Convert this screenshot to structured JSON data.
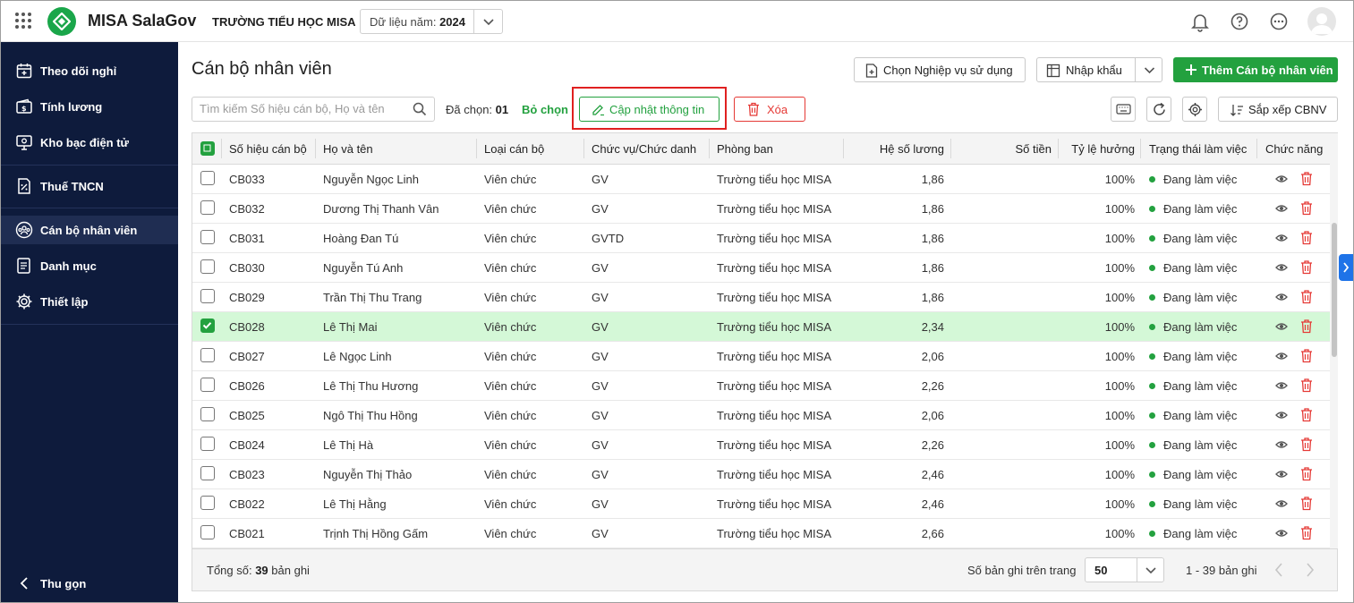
{
  "header": {
    "app_name": "MISA SalaGov",
    "org_name": "TRƯỜNG TIỂU HỌC MISA",
    "year_label": "Dữ liệu năm: ",
    "year_value": "2024",
    "brand_color": "#1aa64a"
  },
  "sidebar": {
    "items": [
      {
        "label": "Theo dõi nghỉ",
        "icon": "calendar-icon"
      },
      {
        "label": "Tính lương",
        "icon": "payroll-icon"
      },
      {
        "label": "Kho bạc điện tử",
        "icon": "treasury-icon"
      },
      {
        "label": "Thuế TNCN",
        "icon": "tax-icon"
      },
      {
        "label": "Cán bộ nhân viên",
        "icon": "staff-icon",
        "active": true
      },
      {
        "label": "Danh mục",
        "icon": "catalog-icon"
      },
      {
        "label": "Thiết lập",
        "icon": "gear-icon"
      }
    ],
    "collapse_label": "Thu gọn"
  },
  "main": {
    "title": "Cán bộ nhân viên",
    "choose_business_label": "Chọn Nghiệp vụ sử dụng",
    "import_label": "Nhập khẩu",
    "add_label": "Thêm Cán bộ nhân viên",
    "search_placeholder": "Tìm kiếm Số hiệu cán bộ, Họ và tên",
    "selected_prefix": "Đã chọn: ",
    "selected_count": "01",
    "deselect_label": "Bỏ chọn",
    "update_label": "Cập nhật thông tin",
    "delete_label": "Xóa",
    "sort_label": "Sắp xếp CBNV"
  },
  "table": {
    "columns": [
      "Số hiệu cán bộ",
      "Họ và tên",
      "Loại cán bộ",
      "Chức vụ/Chức danh",
      "Phòng ban",
      "Hệ số lương",
      "Số tiền",
      "Tỷ lệ hưởng",
      "Trạng thái làm việc",
      "Chức năng"
    ],
    "rows": [
      {
        "id": "CB033",
        "name": "Nguyễn Ngọc Linh",
        "type": "Viên chức",
        "position": "GV",
        "dept": "Trường tiểu học MISA",
        "coef": "1,86",
        "amount": "",
        "rate": "100%",
        "status": "Đang làm việc",
        "checked": false
      },
      {
        "id": "CB032",
        "name": "Dương Thị Thanh Vân",
        "type": "Viên chức",
        "position": "GV",
        "dept": "Trường tiểu học MISA",
        "coef": "1,86",
        "amount": "",
        "rate": "100%",
        "status": "Đang làm việc",
        "checked": false
      },
      {
        "id": "CB031",
        "name": "Hoàng Đan Tú",
        "type": "Viên chức",
        "position": "GVTD",
        "dept": "Trường tiểu học MISA",
        "coef": "1,86",
        "amount": "",
        "rate": "100%",
        "status": "Đang làm việc",
        "checked": false
      },
      {
        "id": "CB030",
        "name": "Nguyễn Tú Anh",
        "type": "Viên chức",
        "position": "GV",
        "dept": "Trường tiểu học MISA",
        "coef": "1,86",
        "amount": "",
        "rate": "100%",
        "status": "Đang làm việc",
        "checked": false
      },
      {
        "id": "CB029",
        "name": "Trần Thị Thu Trang",
        "type": "Viên chức",
        "position": "GV",
        "dept": "Trường tiểu học MISA",
        "coef": "1,86",
        "amount": "",
        "rate": "100%",
        "status": "Đang làm việc",
        "checked": false
      },
      {
        "id": "CB028",
        "name": "Lê Thị Mai",
        "type": "Viên chức",
        "position": "GV",
        "dept": "Trường tiểu học MISA",
        "coef": "2,34",
        "amount": "",
        "rate": "100%",
        "status": "Đang làm việc",
        "checked": true
      },
      {
        "id": "CB027",
        "name": "Lê Ngọc Linh",
        "type": "Viên chức",
        "position": "GV",
        "dept": "Trường tiểu học MISA",
        "coef": "2,06",
        "amount": "",
        "rate": "100%",
        "status": "Đang làm việc",
        "checked": false
      },
      {
        "id": "CB026",
        "name": "Lê Thị Thu Hương",
        "type": "Viên chức",
        "position": "GV",
        "dept": "Trường tiểu học MISA",
        "coef": "2,26",
        "amount": "",
        "rate": "100%",
        "status": "Đang làm việc",
        "checked": false
      },
      {
        "id": "CB025",
        "name": "Ngô Thị Thu Hồng",
        "type": "Viên chức",
        "position": "GV",
        "dept": "Trường tiểu học MISA",
        "coef": "2,06",
        "amount": "",
        "rate": "100%",
        "status": "Đang làm việc",
        "checked": false
      },
      {
        "id": "CB024",
        "name": "Lê Thị Hà",
        "type": "Viên chức",
        "position": "GV",
        "dept": "Trường tiểu học MISA",
        "coef": "2,26",
        "amount": "",
        "rate": "100%",
        "status": "Đang làm việc",
        "checked": false
      },
      {
        "id": "CB023",
        "name": "Nguyễn Thị Thảo",
        "type": "Viên chức",
        "position": "GV",
        "dept": "Trường tiểu học MISA",
        "coef": "2,46",
        "amount": "",
        "rate": "100%",
        "status": "Đang làm việc",
        "checked": false
      },
      {
        "id": "CB022",
        "name": "Lê Thị Hằng",
        "type": "Viên chức",
        "position": "GV",
        "dept": "Trường tiểu học MISA",
        "coef": "2,46",
        "amount": "",
        "rate": "100%",
        "status": "Đang làm việc",
        "checked": false
      },
      {
        "id": "CB021",
        "name": "Trịnh Thị Hồng Gấm",
        "type": "Viên chức",
        "position": "GV",
        "dept": "Trường tiểu học MISA",
        "coef": "2,66",
        "amount": "",
        "rate": "100%",
        "status": "Đang làm việc",
        "checked": false
      }
    ]
  },
  "footer": {
    "total_prefix": "Tổng số: ",
    "total_count": "39",
    "total_suffix": " bản ghi",
    "per_page_label": "Số bản ghi trên trang",
    "per_page_value": "50",
    "range_label": "1 - 39 bản ghi"
  },
  "colors": {
    "accent": "#23a13f",
    "sidebar_bg": "#0e1b3c",
    "selected_row": "#d4f8d7",
    "danger": "#e53935",
    "highlight_box": "#e02020"
  }
}
